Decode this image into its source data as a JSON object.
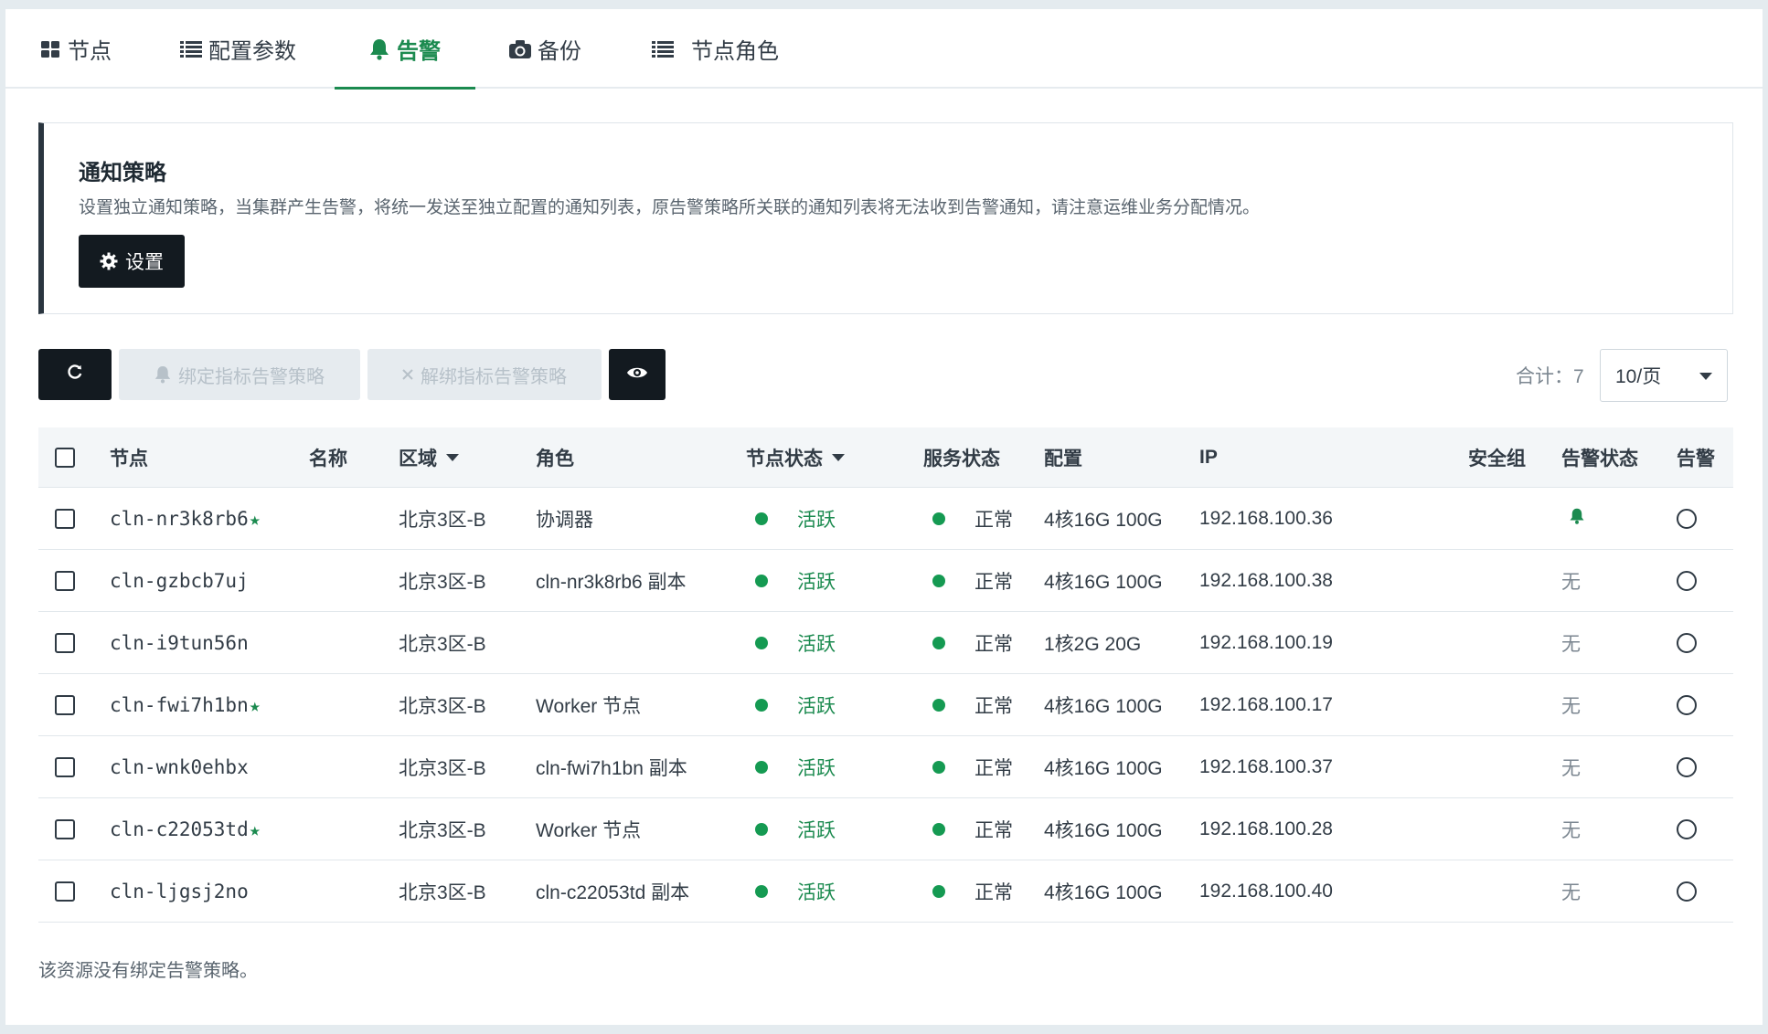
{
  "tabs": [
    {
      "label": "节点",
      "icon": "grid-icon"
    },
    {
      "label": "配置参数",
      "icon": "list-icon"
    },
    {
      "label": "告警",
      "icon": "bell-icon",
      "active": true
    },
    {
      "label": "备份",
      "icon": "camera-icon"
    },
    {
      "label": "节点角色",
      "icon": "list-icon"
    }
  ],
  "notice": {
    "title": "通知策略",
    "description": "设置独立通知策略，当集群产生告警，将统一发送至独立配置的通知列表，原告警策略所关联的通知列表将无法收到告警通知，请注意运维业务分配情况。",
    "button": "设置"
  },
  "toolbar": {
    "bind_label": "绑定指标告警策略",
    "unbind_label": "解绑指标告警策略",
    "total": "合计：7",
    "page_size": "10/页"
  },
  "table": {
    "headers": [
      "节点",
      "名称",
      "区域",
      "角色",
      "节点状态",
      "服务状态",
      "配置",
      "IP",
      "安全组",
      "告警状态",
      "告警"
    ],
    "rows": [
      {
        "node": "cln-nr3k8rb6",
        "star": "★",
        "name": "",
        "zone": "北京3区-B",
        "role": "协调器",
        "node_status": "活跃",
        "service_status": "正常",
        "config": "4核16G 100G",
        "ip": "192.168.100.36",
        "sg": "",
        "alarm_status": "",
        "alarm_bell": true
      },
      {
        "node": "cln-gzbcb7uj",
        "star": "",
        "name": "",
        "zone": "北京3区-B",
        "role": "cln-nr3k8rb6 副本",
        "node_status": "活跃",
        "service_status": "正常",
        "config": "4核16G 100G",
        "ip": "192.168.100.38",
        "sg": "",
        "alarm_status": "无",
        "alarm_bell": false
      },
      {
        "node": "cln-i9tun56n",
        "star": "",
        "name": "",
        "zone": "北京3区-B",
        "role": "",
        "node_status": "活跃",
        "service_status": "正常",
        "config": "1核2G 20G",
        "ip": "192.168.100.19",
        "sg": "",
        "alarm_status": "无",
        "alarm_bell": false
      },
      {
        "node": "cln-fwi7h1bn",
        "star": "★",
        "name": "",
        "zone": "北京3区-B",
        "role": "Worker 节点",
        "node_status": "活跃",
        "service_status": "正常",
        "config": "4核16G 100G",
        "ip": "192.168.100.17",
        "sg": "",
        "alarm_status": "无",
        "alarm_bell": false
      },
      {
        "node": "cln-wnk0ehbx",
        "star": "",
        "name": "",
        "zone": "北京3区-B",
        "role": "cln-fwi7h1bn 副本",
        "node_status": "活跃",
        "service_status": "正常",
        "config": "4核16G 100G",
        "ip": "192.168.100.37",
        "sg": "",
        "alarm_status": "无",
        "alarm_bell": false
      },
      {
        "node": "cln-c22053td",
        "star": "★",
        "name": "",
        "zone": "北京3区-B",
        "role": "Worker 节点",
        "node_status": "活跃",
        "service_status": "正常",
        "config": "4核16G 100G",
        "ip": "192.168.100.28",
        "sg": "",
        "alarm_status": "无",
        "alarm_bell": false
      },
      {
        "node": "cln-ljgsj2no",
        "star": "",
        "name": "",
        "zone": "北京3区-B",
        "role": "cln-c22053td 副本",
        "node_status": "活跃",
        "service_status": "正常",
        "config": "4核16G 100G",
        "ip": "192.168.100.40",
        "sg": "",
        "alarm_status": "无",
        "alarm_bell": false
      }
    ]
  },
  "footer_note": "该资源没有绑定告警策略。",
  "colors": {
    "accent": "#1b8a4f",
    "dark_button": "#131a20",
    "status_dot": "#159a52"
  }
}
